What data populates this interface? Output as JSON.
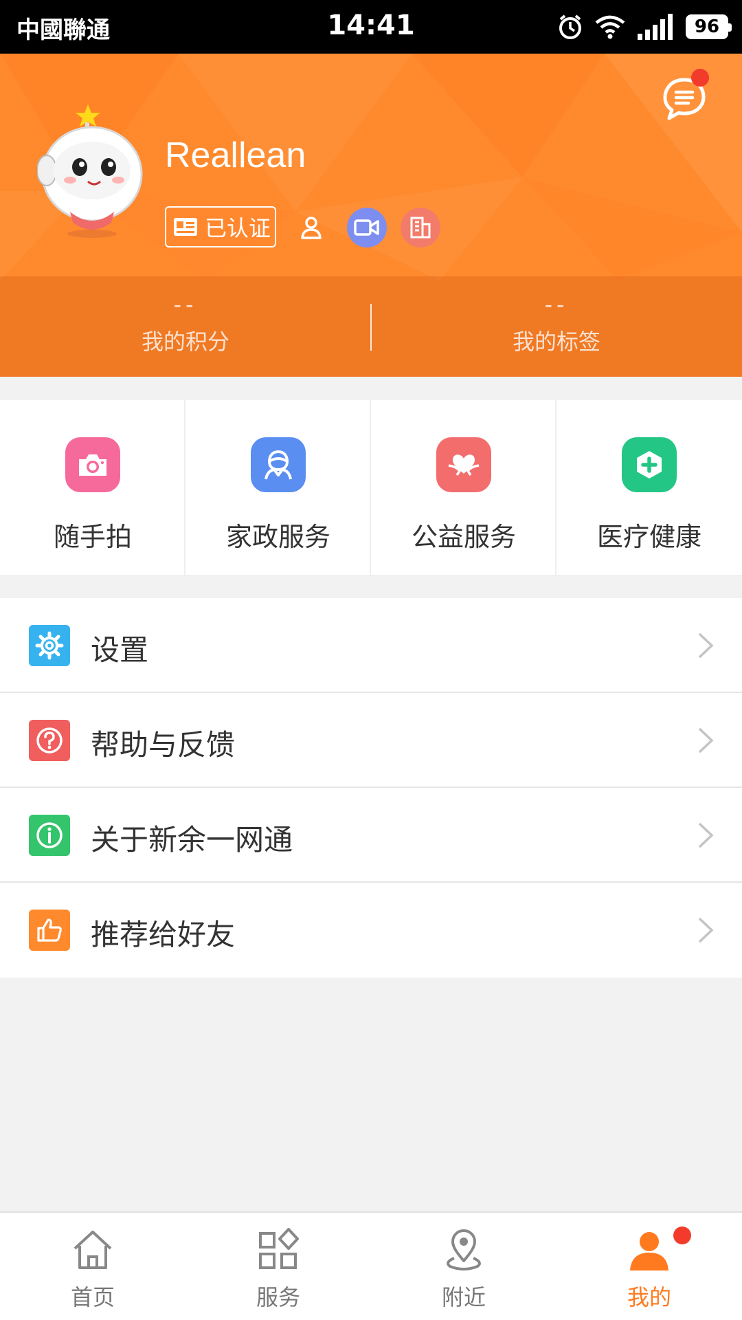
{
  "status_bar": {
    "carrier": "中國聯通",
    "time": "14:41",
    "battery": "96",
    "icons": [
      "alarm-icon",
      "wifi-icon",
      "signal-icon",
      "battery-icon"
    ]
  },
  "profile": {
    "username": "Reallean",
    "verified_label": "已认证",
    "role_icons": [
      "person-icon",
      "video-icon",
      "building-icon"
    ],
    "has_unread_messages": true,
    "stats": [
      {
        "value": "--",
        "label": "我的积分"
      },
      {
        "value": "--",
        "label": "我的标签"
      }
    ]
  },
  "services": [
    {
      "label": "随手拍",
      "icon": "camera-icon",
      "color": "#f6699b"
    },
    {
      "label": "家政服务",
      "icon": "housekeeper-icon",
      "color": "#5a8ef0"
    },
    {
      "label": "公益服务",
      "icon": "heart-hands-icon",
      "color": "#f36d6d"
    },
    {
      "label": "医疗健康",
      "icon": "medical-plus-icon",
      "color": "#23c685"
    }
  ],
  "menu": [
    {
      "label": "设置",
      "icon": "gear-icon",
      "color": "#36b3ef"
    },
    {
      "label": "帮助与反馈",
      "icon": "question-icon",
      "color": "#f05e5e"
    },
    {
      "label": "关于新余一网通",
      "icon": "info-icon",
      "color": "#33c46c"
    },
    {
      "label": "推荐给好友",
      "icon": "thumbs-up-icon",
      "color": "#ff8a2e"
    }
  ],
  "bottom_nav": [
    {
      "label": "首页",
      "icon": "home-icon",
      "active": false
    },
    {
      "label": "服务",
      "icon": "services-grid-icon",
      "active": false
    },
    {
      "label": "附近",
      "icon": "location-pin-icon",
      "active": false
    },
    {
      "label": "我的",
      "icon": "profile-icon",
      "active": true
    }
  ],
  "colors": {
    "accent": "#ff8a2e",
    "active_tab": "#ff7a1f",
    "notification_dot": "#f33b2c"
  }
}
